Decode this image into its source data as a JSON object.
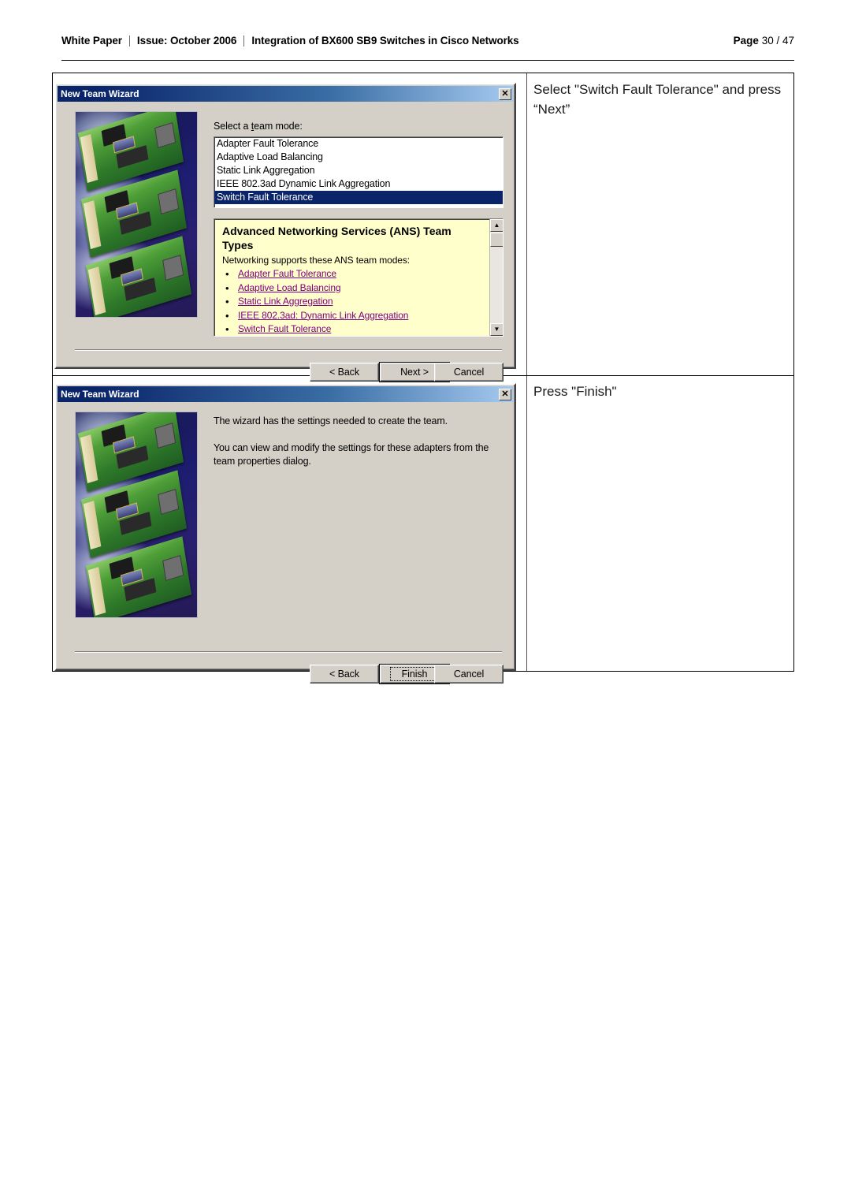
{
  "header": {
    "doc_type": "White Paper",
    "issue": "Issue: October 2006",
    "title": "Integration of BX600 SB9 Switches in Cisco Networks",
    "page_label": "Page",
    "page_value": "30 / 47"
  },
  "table": {
    "rows": [
      {
        "caption": "Select \"Switch Fault Tolerance\" and press “Next”",
        "dialog": {
          "title": "New Team Wizard",
          "close_icon": "✕",
          "image_alt": "three-stacked-network-adapter-cards",
          "list_label": "Select a ",
          "list_label_accel": "t",
          "list_label_rest": "eam mode:",
          "list_items": [
            {
              "label": "Adapter Fault Tolerance",
              "selected": false
            },
            {
              "label": "Adaptive Load Balancing",
              "selected": false
            },
            {
              "label": "Static Link Aggregation",
              "selected": false
            },
            {
              "label": "IEEE 802.3ad Dynamic Link Aggregation",
              "selected": false
            },
            {
              "label": "Switch Fault Tolerance",
              "selected": true
            }
          ],
          "help": {
            "title": "Advanced Networking Services (ANS) Team Types",
            "subtitle": "Networking supports these ANS team modes:",
            "links": [
              "Adapter Fault Tolerance",
              "Adaptive Load Balancing",
              "Static Link Aggregation",
              "IEEE 802.3ad: Dynamic Link Aggregation",
              "Switch Fault Tolerance"
            ],
            "scroll_up_icon": "▲",
            "scroll_down_icon": "▼"
          },
          "buttons": {
            "back": "< Back",
            "back_accel": "B",
            "primary": "Next >",
            "primary_accel": "N",
            "cancel": "Cancel"
          }
        }
      },
      {
        "caption": "Press \"Finish\"",
        "dialog": {
          "title": "New Team Wizard",
          "close_icon": "✕",
          "image_alt": "three-stacked-network-adapter-cards",
          "info_line1": "The wizard has the settings needed to create the team.",
          "info_line2": "You can view and modify the settings for these adapters from the team properties dialog.",
          "buttons": {
            "back": "< Back",
            "back_accel": "B",
            "primary": "Finish",
            "cancel": "Cancel"
          }
        }
      }
    ]
  },
  "colors": {
    "titlebar_start": "#0a246a",
    "titlebar_end": "#a6caf0",
    "dialog_face": "#d4d0c8",
    "selection": "#0a246a",
    "help_background": "#ffffcc",
    "link": "#800080"
  }
}
